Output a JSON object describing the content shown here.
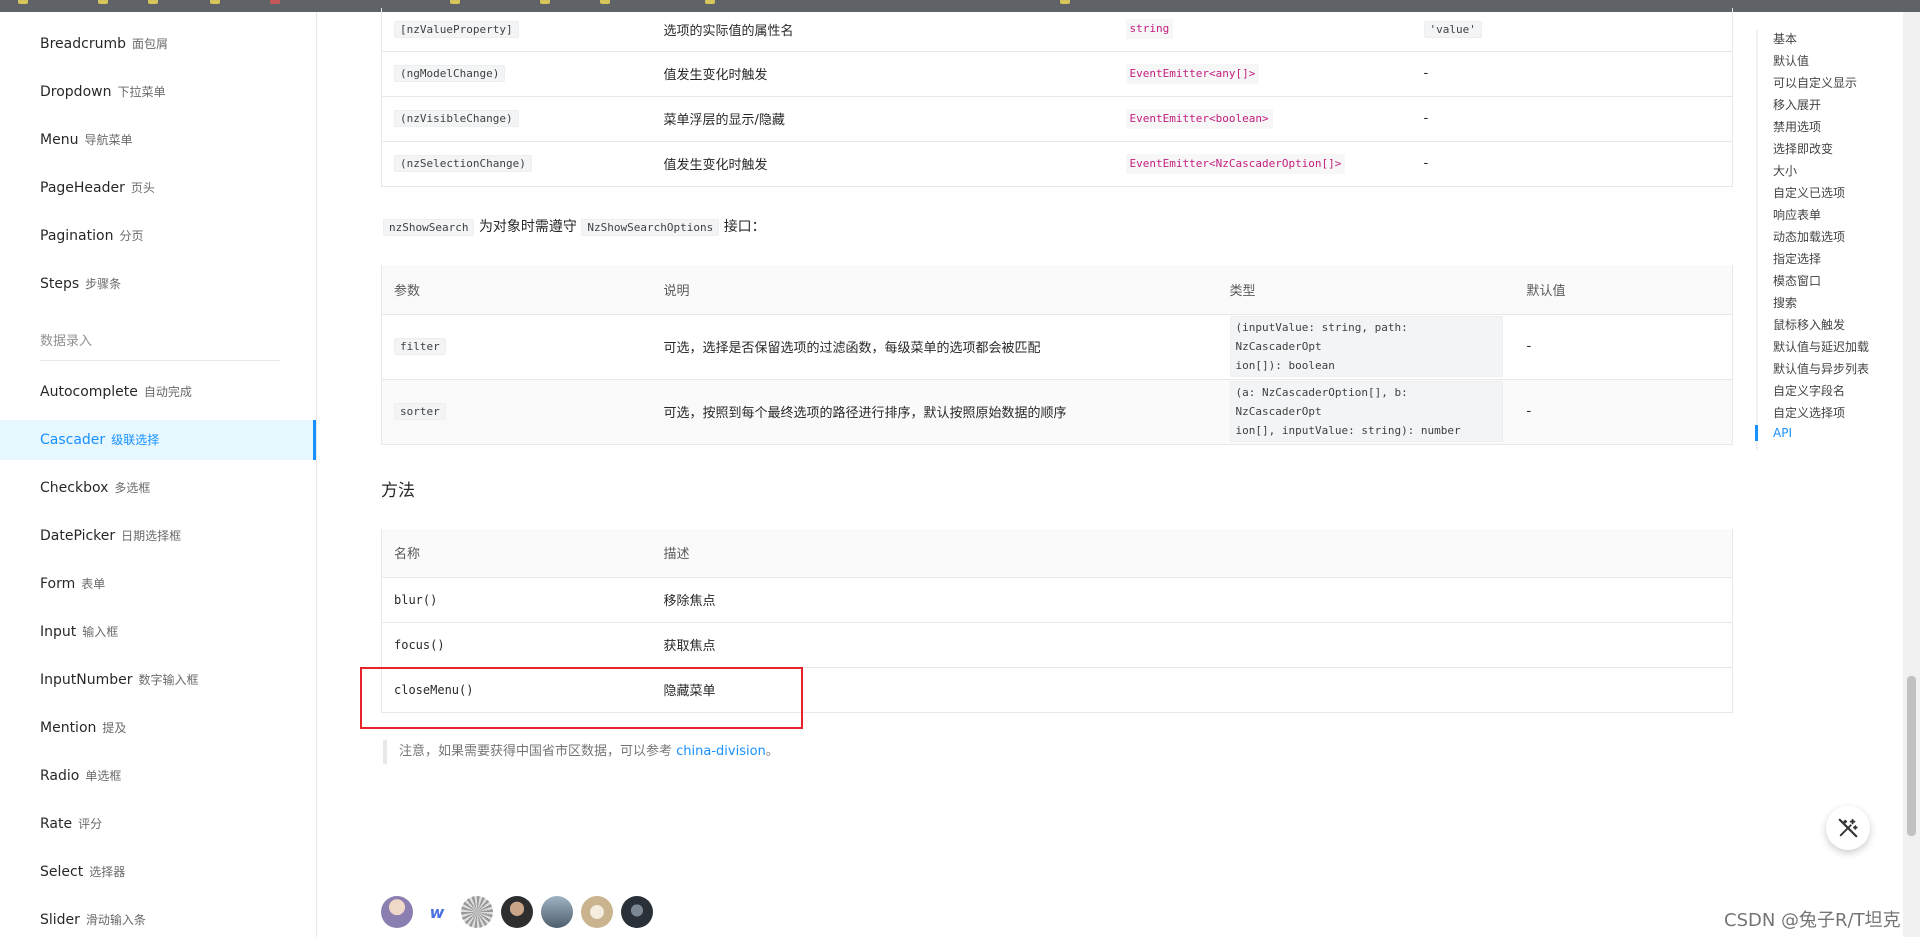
{
  "sidebar": {
    "items": [
      {
        "en": "Breadcrumb",
        "zh": "面包屑"
      },
      {
        "en": "Dropdown",
        "zh": "下拉菜单"
      },
      {
        "en": "Menu",
        "zh": "导航菜单"
      },
      {
        "en": "PageHeader",
        "zh": "页头"
      },
      {
        "en": "Pagination",
        "zh": "分页"
      },
      {
        "en": "Steps",
        "zh": "步骤条"
      }
    ],
    "group_label": "数据录入",
    "items2": [
      {
        "en": "Autocomplete",
        "zh": "自动完成"
      },
      {
        "en": "Cascader",
        "zh": "级联选择"
      },
      {
        "en": "Checkbox",
        "zh": "多选框"
      },
      {
        "en": "DatePicker",
        "zh": "日期选择框"
      },
      {
        "en": "Form",
        "zh": "表单"
      },
      {
        "en": "Input",
        "zh": "输入框"
      },
      {
        "en": "InputNumber",
        "zh": "数字输入框"
      },
      {
        "en": "Mention",
        "zh": "提及"
      },
      {
        "en": "Radio",
        "zh": "单选框"
      },
      {
        "en": "Rate",
        "zh": "评分"
      },
      {
        "en": "Select",
        "zh": "选择器"
      },
      {
        "en": "Slider",
        "zh": "滑动输入条"
      }
    ],
    "active": "Cascader"
  },
  "props_table": {
    "rows": [
      {
        "param": "[nzValueProperty]",
        "desc": "选项的实际值的属性名",
        "type": "string",
        "default": "'value'"
      },
      {
        "param": "(ngModelChange)",
        "desc": "值发生变化时触发",
        "type": "EventEmitter<any[]>",
        "default": "-"
      },
      {
        "param": "(nzVisibleChange)",
        "desc": "菜单浮层的显示/隐藏",
        "type": "EventEmitter<boolean>",
        "default": "-"
      },
      {
        "param": "(nzSelectionChange)",
        "desc": "值发生变化时触发",
        "type": "EventEmitter<NzCascaderOption[]>",
        "default": "-"
      }
    ]
  },
  "inline_note": {
    "code1": "nzShowSearch",
    "text1": "为对象时需遵守",
    "code2": "NzShowSearchOptions",
    "text2": "接口："
  },
  "search_table": {
    "headers": [
      "参数",
      "说明",
      "类型",
      "默认值"
    ],
    "rows": [
      {
        "param": "filter",
        "desc": "可选，选择是否保留选项的过滤函数，每级菜单的选项都会被匹配",
        "type_line1": "(inputValue: string, path: NzCascaderOpt",
        "type_line2": "ion[]): boolean",
        "default": "-"
      },
      {
        "param": "sorter",
        "desc": "可选，按照到每个最终选项的路径进行排序，默认按照原始数据的顺序",
        "type_line1": "(a: NzCascaderOption[], b: NzCascaderOpt",
        "type_line2": "ion[], inputValue: string): number",
        "default": "-"
      }
    ]
  },
  "methods_section": {
    "title": "方法",
    "headers": [
      "名称",
      "描述"
    ],
    "rows": [
      {
        "name": "blur()",
        "desc": "移除焦点"
      },
      {
        "name": "focus()",
        "desc": "获取焦点"
      },
      {
        "name": "closeMenu()",
        "desc": "隐藏菜单"
      }
    ]
  },
  "footnote": {
    "text": "注意，如果需要获得中国省市区数据，可以参考 ",
    "link": "china-division",
    "suffix": "。"
  },
  "anchor_nav": {
    "items": [
      "基本",
      "默认值",
      "可以自定义显示",
      "移入展开",
      "禁用选项",
      "选择即改变",
      "大小",
      "自定义已选项",
      "响应表单",
      "动态加载选项",
      "指定选择",
      "模态窗口",
      "搜索",
      "鼠标移入触发",
      "默认值与延迟加载",
      "默认值与异步列表",
      "自定义字段名",
      "自定义选择项",
      "API"
    ],
    "active": "API"
  },
  "watermark": "CSDN @兔子R/T坦克",
  "colors": {
    "primary": "#1890ff",
    "highlight_box": "#e8232a",
    "type_code": "#c41d7f"
  },
  "avatar_colors": [
    "#8a7fb0",
    "#ffffff",
    "#b8b8b8",
    "#4a4a4a",
    "#6b7f92",
    "#d8c7a8",
    "#3d4450"
  ]
}
